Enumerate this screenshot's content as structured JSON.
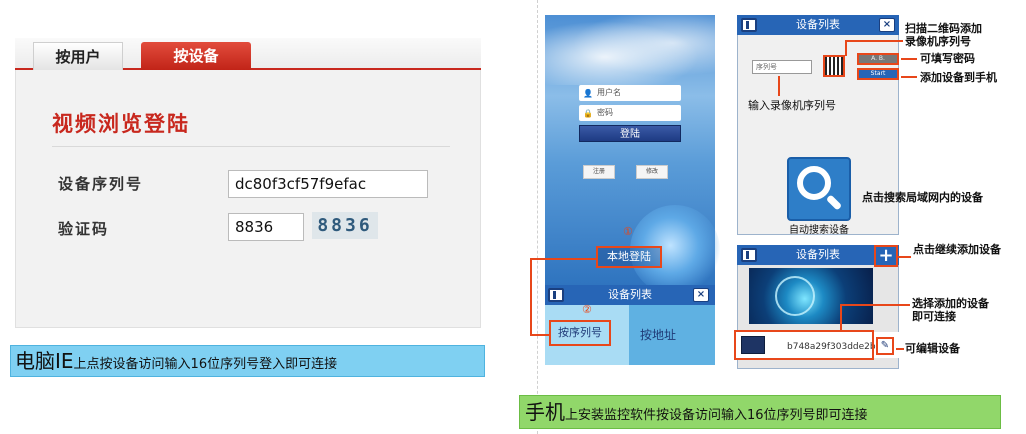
{
  "pc": {
    "tabs": {
      "user": "按用户",
      "device": "按设备"
    },
    "title": "视频浏览登陆",
    "serial_label": "设备序列号",
    "serial_value": "dc80f3cf57f9efac",
    "captcha_label": "验证码",
    "captcha_value": "8836",
    "captcha_image_text": "8836",
    "caption_big": "电脑IE",
    "caption_rest": "上点按设备访问输入16位序列号登入即可连接"
  },
  "phone_login": {
    "username_placeholder": "用户名",
    "password_placeholder": "密码",
    "login_button": "登陆",
    "register_button": "注册",
    "modify_button": "修改",
    "step1": "①",
    "local_login": "本地登陆"
  },
  "device_list_mini": {
    "title": "设备列表",
    "step2": "②",
    "by_serial": "按序列号",
    "by_address": "按地址"
  },
  "add_screen": {
    "title": "设备列表",
    "serial_placeholder": "序列号",
    "pwd_box": "A. B.",
    "start_box": "Start",
    "input_serial_label": "输入录像机序列号",
    "auto_search": "自动搜索设备"
  },
  "list_screen": {
    "title": "设备列表",
    "add_symbol": "+",
    "device_serial": "b748a29f303dde2b",
    "edit_symbol": "✎"
  },
  "notes": {
    "scan": "扫描二维码添加\n录像机序列号",
    "pwd": "可填写密码",
    "add_phone": "添加设备到手机",
    "search": "点击搜索局域网内的设备",
    "continue": "点击继续添加设备",
    "select": "选择添加的设备\n即可连接",
    "edit": "可编辑设备"
  },
  "phone_caption": {
    "big": "手机",
    "rest": "上安装监控软件按设备访问输入16位序列号即可连接"
  },
  "colors": {
    "accent_red": "#c8281e",
    "highlight_orange": "#e8471a",
    "header_blue": "#2765b6",
    "caption_blue": "#7fd0f2",
    "caption_green": "#91d76a"
  }
}
